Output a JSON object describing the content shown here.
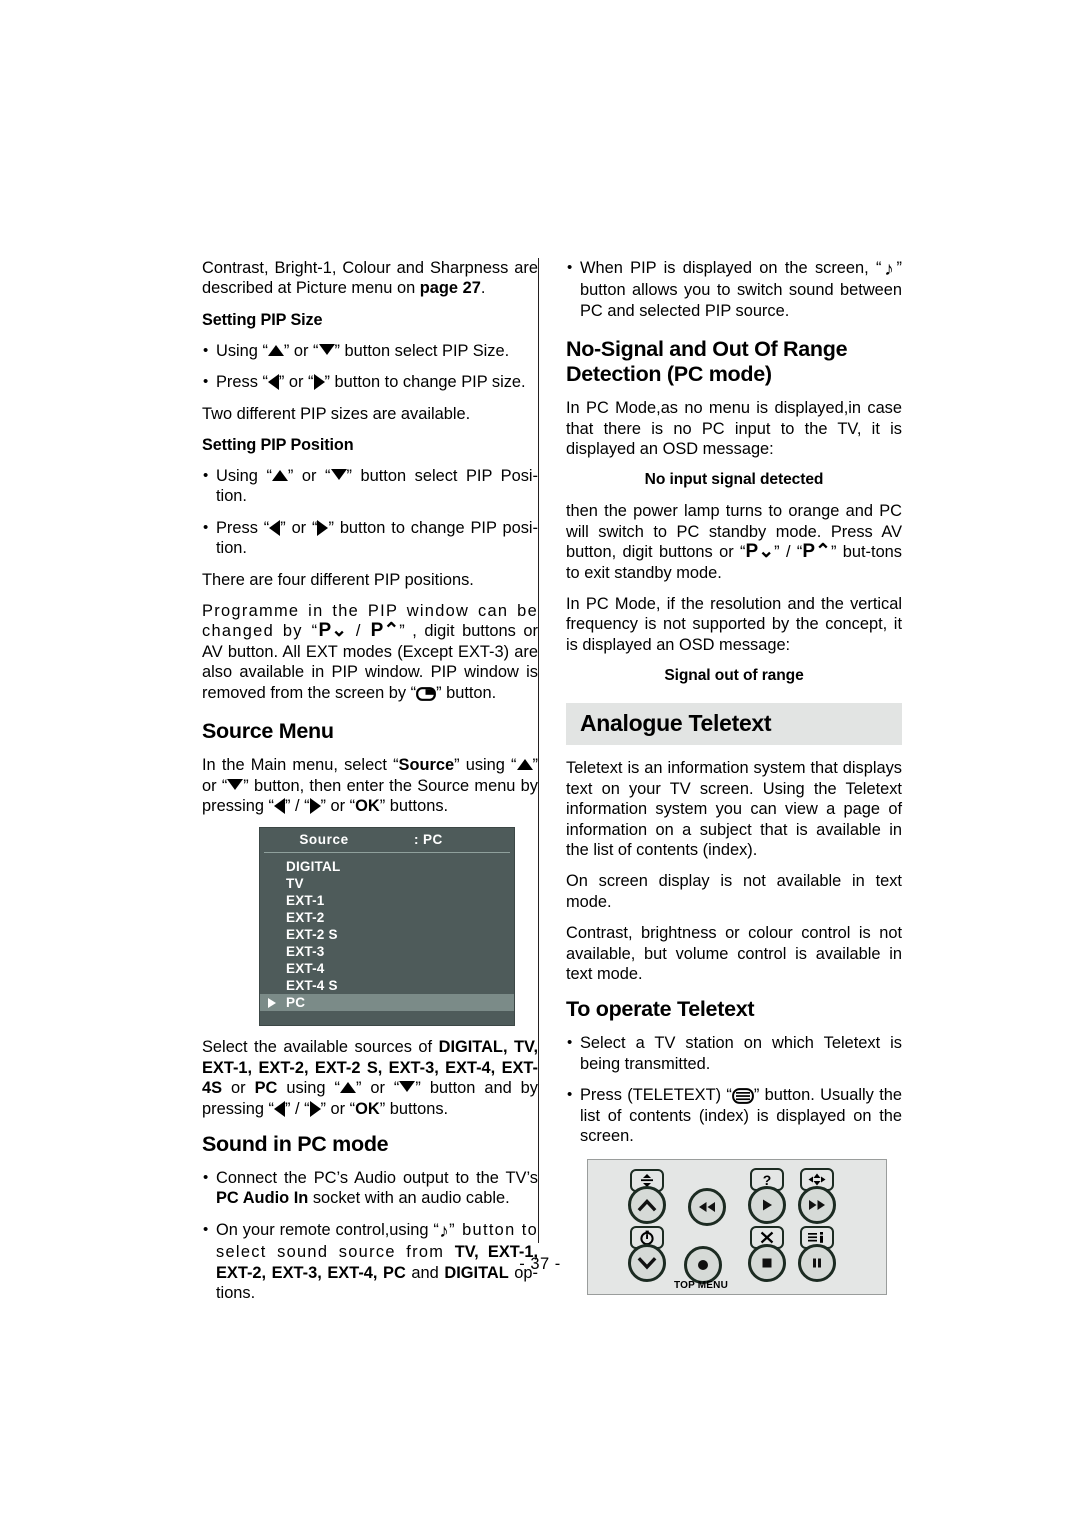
{
  "page": {
    "number_label": "- 37 -"
  },
  "left_column": {
    "intro": {
      "text_before": "Contrast, Bright-1, Colour and Sharpness are described at Picture menu on ",
      "bold_ref": "page 27",
      "text_after": "."
    },
    "pip_size": {
      "heading": "Setting PIP Size",
      "bullet1_a": "Using “",
      "bullet1_b": "” or “",
      "bullet1_c": "” button select PIP Size.",
      "bullet2_a": "Press “",
      "bullet2_b": "” or “",
      "bullet2_c": "” button to change PIP size.",
      "note": "Two different PIP sizes are available."
    },
    "pip_position": {
      "heading": "Setting PIP Position",
      "bullet1_a": "Using “",
      "bullet1_b": "” or “",
      "bullet1_c": "” button select PIP Posi-tion.",
      "bullet2_a": "Press “",
      "bullet2_b": "” or “",
      "bullet2_c": "” button to change PIP posi-tion.",
      "note": "There are four different PIP positions.",
      "paragraph_a": "Programme in the PIP window can be changed by “",
      "paragraph_b": "” , digit buttons or AV button. All EXT modes (Except EXT-3) are also available in PIP window. PIP window is removed from the screen by “",
      "paragraph_c": "” button."
    },
    "source_menu": {
      "heading": "Source Menu",
      "intro_a": "In the Main menu, select “",
      "intro_source": "Source",
      "intro_b": "” using “",
      "intro_c": "” or “",
      "intro_d": "” button, then enter the Source menu by pressing “",
      "intro_e": "” / “",
      "intro_f": "” or “",
      "intro_ok": "OK",
      "intro_g": "” buttons.",
      "osd": {
        "title": "Source",
        "value": ": PC",
        "items": [
          {
            "label": "DIGITAL",
            "selected": false
          },
          {
            "label": "TV",
            "selected": false
          },
          {
            "label": "EXT-1",
            "selected": false
          },
          {
            "label": "EXT-2",
            "selected": false
          },
          {
            "label": "EXT-2 S",
            "selected": false
          },
          {
            "label": "EXT-3",
            "selected": false
          },
          {
            "label": "EXT-4",
            "selected": false
          },
          {
            "label": "EXT-4 S",
            "selected": false
          },
          {
            "label": "PC",
            "selected": true
          }
        ]
      },
      "after_a": "Select the available sources of ",
      "after_bold1": "DIGITAL, TV, EXT-1, EXT-2, EXT-2 S, EXT-3, EXT-4, EXT-4S",
      "after_b": " or ",
      "after_bold2": "PC",
      "after_c": " using “",
      "after_d": "” or “",
      "after_e": "” button and by pressing “",
      "after_f": "” / “",
      "after_g": "” or “",
      "after_ok": "OK",
      "after_h": "” buttons."
    },
    "sound_pc": {
      "heading": "Sound in PC mode",
      "bullet1_a": "Connect the PC’s Audio output to the TV’s ",
      "bullet1_bold": "PC Audio In",
      "bullet1_b": " socket with an audio cable.",
      "bullet2_a": "On your remote control,using “",
      "bullet2_b": "” button to select sound source from ",
      "bullet2_bold1": "TV, EXT-1, EXT-2, EXT-3, EXT-4, PC",
      "bullet2_c": " and ",
      "bullet2_bold2": "DIGITAL",
      "bullet2_d": " op-tions."
    }
  },
  "right_column": {
    "pip_sound": {
      "bullet_a": "When PIP is displayed on the screen, “",
      "bullet_b": "” button allows you to switch sound between PC and selected PIP source."
    },
    "no_signal": {
      "heading_line1": "No-Signal and Out Of Range",
      "heading_line2": "Detection (PC mode)",
      "paragraph1": "In PC Mode,as no menu is displayed,in case that there is no PC input to the TV, it is displayed an OSD message:",
      "osd_message1": "No input signal detected",
      "paragraph2_a": "then the power lamp turns to orange and PC will switch to PC standby mode. Press AV button, digit buttons or “",
      "paragraph2_b": "” / “",
      "paragraph2_c": "” but-tons to exit standby mode.",
      "paragraph3": "In PC Mode, if the resolution and the vertical frequency is not supported by the concept, it is displayed an OSD message:",
      "osd_message2": "Signal out of range"
    },
    "teletext": {
      "banner": "Analogue Teletext",
      "paragraph1": "Teletext is an information system that displays text on your TV screen. Using the Teletext information system you can view a page of information on a subject that is available in the list of contents (index).",
      "paragraph2": "On screen display is not available in text mode.",
      "paragraph3": "Contrast, brightness or colour control is not available, but volume control is available in text mode."
    },
    "operate_teletext": {
      "heading": "To operate Teletext",
      "bullet1": "Select a TV station on which Teletext is being transmitted.",
      "bullet2_a": "Press (TELETEXT) “",
      "bullet2_b": "” button. Usually the list of contents (index) is displayed on the screen."
    },
    "remote_diagram": {
      "top_menu_label": "TOP MENU",
      "buttons": [
        {
          "name": "reveal-cap",
          "glyph": "↕"
        },
        {
          "name": "up-button",
          "glyph": "⌃"
        },
        {
          "name": "rewind-button",
          "glyph": "◀◀"
        },
        {
          "name": "help-cap",
          "glyph": "?"
        },
        {
          "name": "play-button",
          "glyph": "▶"
        },
        {
          "name": "size-cap",
          "glyph": "↕"
        },
        {
          "name": "forward-button",
          "glyph": "▶▶"
        },
        {
          "name": "timer-cap",
          "glyph": "⏱"
        },
        {
          "name": "down-button",
          "glyph": "⌄"
        },
        {
          "name": "record-button",
          "glyph": "●"
        },
        {
          "name": "cancel-cap",
          "glyph": "✕"
        },
        {
          "name": "stop-button",
          "glyph": "■"
        },
        {
          "name": "index-cap",
          "glyph": "i"
        },
        {
          "name": "pause-button",
          "glyph": "❙❙"
        }
      ]
    }
  }
}
